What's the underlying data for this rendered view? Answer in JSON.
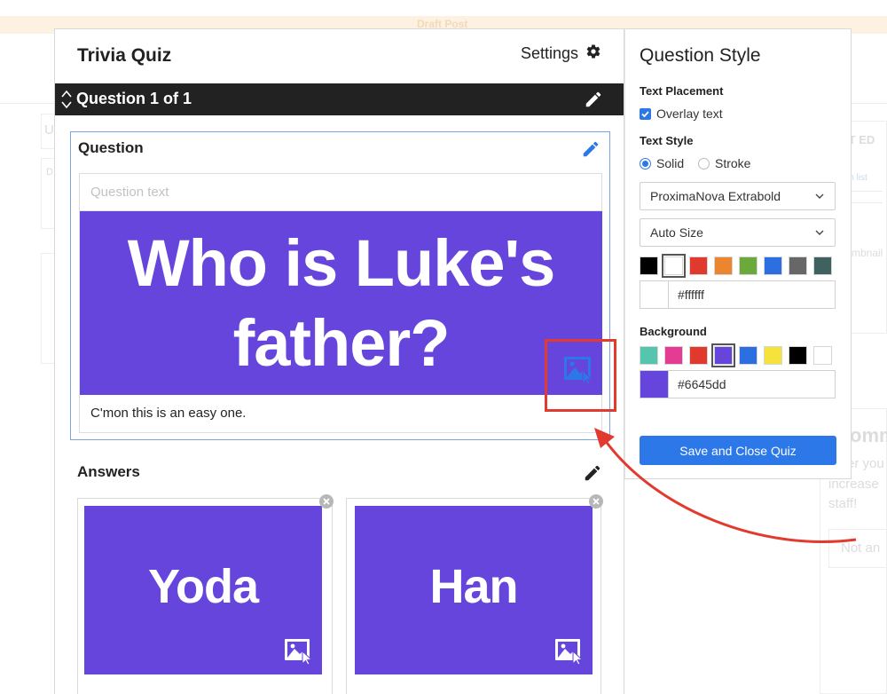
{
  "background": {
    "draft_label": "Draft Post",
    "fragments": [
      "U",
      "D",
      "ST ED",
      "in list",
      "mbnail",
      "omm",
      "er you",
      "increase",
      "staff!",
      "Not an"
    ]
  },
  "quiz": {
    "title": "Trivia Quiz",
    "settings_label": "Settings",
    "question_bar_title": "Question  1 of 1",
    "question_heading": "Question",
    "question_placeholder": "Question text",
    "question_value": "",
    "question_image_text": "Who is Luke's father?",
    "question_caption": "C'mon this is an easy one.",
    "answers_heading": "Answers",
    "answers": [
      {
        "text": "Yoda"
      },
      {
        "text": "Han"
      }
    ]
  },
  "style_panel": {
    "title": "Question Style",
    "text_placement_label": "Text Placement",
    "overlay_text_label": "Overlay text",
    "overlay_text_checked": true,
    "text_style_label": "Text Style",
    "style_options": [
      {
        "label": "Solid",
        "selected": true
      },
      {
        "label": "Stroke",
        "selected": false
      }
    ],
    "font_select": "ProximaNova Extrabold",
    "size_select": "Auto Size",
    "text_colors": [
      "#000000",
      "#ffffff",
      "#e03a2e",
      "#ec8530",
      "#6aaa3c",
      "#2c6fe0",
      "#676767",
      "#3f6160"
    ],
    "text_color_selected": "#ffffff",
    "text_color_value": "#ffffff",
    "background_label": "Background",
    "background_colors": [
      "#55c5ae",
      "#e33c92",
      "#e03a2e",
      "#6645dd",
      "#2c6fe0",
      "#f5e33b",
      "#000000",
      "#ffffff"
    ],
    "background_color_selected": "#6645dd",
    "background_color_value": "#6645dd",
    "save_button_label": "Save and Close Quiz"
  },
  "colors": {
    "accent": "#2c78e8",
    "highlight": "#e23a2e",
    "image_bg": "#6645dd"
  }
}
